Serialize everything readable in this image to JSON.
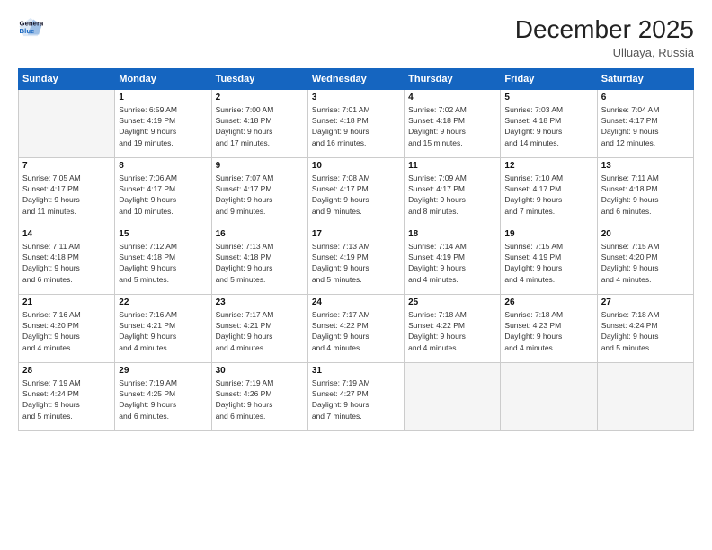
{
  "logo": {
    "line1": "General",
    "line2": "Blue"
  },
  "title": "December 2025",
  "location": "Ulluaya, Russia",
  "days_header": [
    "Sunday",
    "Monday",
    "Tuesday",
    "Wednesday",
    "Thursday",
    "Friday",
    "Saturday"
  ],
  "weeks": [
    [
      {
        "day": "",
        "sunrise": "",
        "sunset": "",
        "daylight": "",
        "empty": true
      },
      {
        "day": "1",
        "sunrise": "Sunrise: 6:59 AM",
        "sunset": "Sunset: 4:19 PM",
        "daylight": "Daylight: 9 hours and 19 minutes."
      },
      {
        "day": "2",
        "sunrise": "Sunrise: 7:00 AM",
        "sunset": "Sunset: 4:18 PM",
        "daylight": "Daylight: 9 hours and 17 minutes."
      },
      {
        "day": "3",
        "sunrise": "Sunrise: 7:01 AM",
        "sunset": "Sunset: 4:18 PM",
        "daylight": "Daylight: 9 hours and 16 minutes."
      },
      {
        "day": "4",
        "sunrise": "Sunrise: 7:02 AM",
        "sunset": "Sunset: 4:18 PM",
        "daylight": "Daylight: 9 hours and 15 minutes."
      },
      {
        "day": "5",
        "sunrise": "Sunrise: 7:03 AM",
        "sunset": "Sunset: 4:18 PM",
        "daylight": "Daylight: 9 hours and 14 minutes."
      },
      {
        "day": "6",
        "sunrise": "Sunrise: 7:04 AM",
        "sunset": "Sunset: 4:17 PM",
        "daylight": "Daylight: 9 hours and 12 minutes."
      }
    ],
    [
      {
        "day": "7",
        "sunrise": "Sunrise: 7:05 AM",
        "sunset": "Sunset: 4:17 PM",
        "daylight": "Daylight: 9 hours and 11 minutes."
      },
      {
        "day": "8",
        "sunrise": "Sunrise: 7:06 AM",
        "sunset": "Sunset: 4:17 PM",
        "daylight": "Daylight: 9 hours and 10 minutes."
      },
      {
        "day": "9",
        "sunrise": "Sunrise: 7:07 AM",
        "sunset": "Sunset: 4:17 PM",
        "daylight": "Daylight: 9 hours and 9 minutes."
      },
      {
        "day": "10",
        "sunrise": "Sunrise: 7:08 AM",
        "sunset": "Sunset: 4:17 PM",
        "daylight": "Daylight: 9 hours and 9 minutes."
      },
      {
        "day": "11",
        "sunrise": "Sunrise: 7:09 AM",
        "sunset": "Sunset: 4:17 PM",
        "daylight": "Daylight: 9 hours and 8 minutes."
      },
      {
        "day": "12",
        "sunrise": "Sunrise: 7:10 AM",
        "sunset": "Sunset: 4:17 PM",
        "daylight": "Daylight: 9 hours and 7 minutes."
      },
      {
        "day": "13",
        "sunrise": "Sunrise: 7:11 AM",
        "sunset": "Sunset: 4:18 PM",
        "daylight": "Daylight: 9 hours and 6 minutes."
      }
    ],
    [
      {
        "day": "14",
        "sunrise": "Sunrise: 7:11 AM",
        "sunset": "Sunset: 4:18 PM",
        "daylight": "Daylight: 9 hours and 6 minutes."
      },
      {
        "day": "15",
        "sunrise": "Sunrise: 7:12 AM",
        "sunset": "Sunset: 4:18 PM",
        "daylight": "Daylight: 9 hours and 5 minutes."
      },
      {
        "day": "16",
        "sunrise": "Sunrise: 7:13 AM",
        "sunset": "Sunset: 4:18 PM",
        "daylight": "Daylight: 9 hours and 5 minutes."
      },
      {
        "day": "17",
        "sunrise": "Sunrise: 7:13 AM",
        "sunset": "Sunset: 4:19 PM",
        "daylight": "Daylight: 9 hours and 5 minutes."
      },
      {
        "day": "18",
        "sunrise": "Sunrise: 7:14 AM",
        "sunset": "Sunset: 4:19 PM",
        "daylight": "Daylight: 9 hours and 4 minutes."
      },
      {
        "day": "19",
        "sunrise": "Sunrise: 7:15 AM",
        "sunset": "Sunset: 4:19 PM",
        "daylight": "Daylight: 9 hours and 4 minutes."
      },
      {
        "day": "20",
        "sunrise": "Sunrise: 7:15 AM",
        "sunset": "Sunset: 4:20 PM",
        "daylight": "Daylight: 9 hours and 4 minutes."
      }
    ],
    [
      {
        "day": "21",
        "sunrise": "Sunrise: 7:16 AM",
        "sunset": "Sunset: 4:20 PM",
        "daylight": "Daylight: 9 hours and 4 minutes."
      },
      {
        "day": "22",
        "sunrise": "Sunrise: 7:16 AM",
        "sunset": "Sunset: 4:21 PM",
        "daylight": "Daylight: 9 hours and 4 minutes."
      },
      {
        "day": "23",
        "sunrise": "Sunrise: 7:17 AM",
        "sunset": "Sunset: 4:21 PM",
        "daylight": "Daylight: 9 hours and 4 minutes."
      },
      {
        "day": "24",
        "sunrise": "Sunrise: 7:17 AM",
        "sunset": "Sunset: 4:22 PM",
        "daylight": "Daylight: 9 hours and 4 minutes."
      },
      {
        "day": "25",
        "sunrise": "Sunrise: 7:18 AM",
        "sunset": "Sunset: 4:22 PM",
        "daylight": "Daylight: 9 hours and 4 minutes."
      },
      {
        "day": "26",
        "sunrise": "Sunrise: 7:18 AM",
        "sunset": "Sunset: 4:23 PM",
        "daylight": "Daylight: 9 hours and 4 minutes."
      },
      {
        "day": "27",
        "sunrise": "Sunrise: 7:18 AM",
        "sunset": "Sunset: 4:24 PM",
        "daylight": "Daylight: 9 hours and 5 minutes."
      }
    ],
    [
      {
        "day": "28",
        "sunrise": "Sunrise: 7:19 AM",
        "sunset": "Sunset: 4:24 PM",
        "daylight": "Daylight: 9 hours and 5 minutes."
      },
      {
        "day": "29",
        "sunrise": "Sunrise: 7:19 AM",
        "sunset": "Sunset: 4:25 PM",
        "daylight": "Daylight: 9 hours and 6 minutes."
      },
      {
        "day": "30",
        "sunrise": "Sunrise: 7:19 AM",
        "sunset": "Sunset: 4:26 PM",
        "daylight": "Daylight: 9 hours and 6 minutes."
      },
      {
        "day": "31",
        "sunrise": "Sunrise: 7:19 AM",
        "sunset": "Sunset: 4:27 PM",
        "daylight": "Daylight: 9 hours and 7 minutes."
      },
      {
        "day": "",
        "sunrise": "",
        "sunset": "",
        "daylight": "",
        "empty": true
      },
      {
        "day": "",
        "sunrise": "",
        "sunset": "",
        "daylight": "",
        "empty": true
      },
      {
        "day": "",
        "sunrise": "",
        "sunset": "",
        "daylight": "",
        "empty": true
      }
    ]
  ]
}
